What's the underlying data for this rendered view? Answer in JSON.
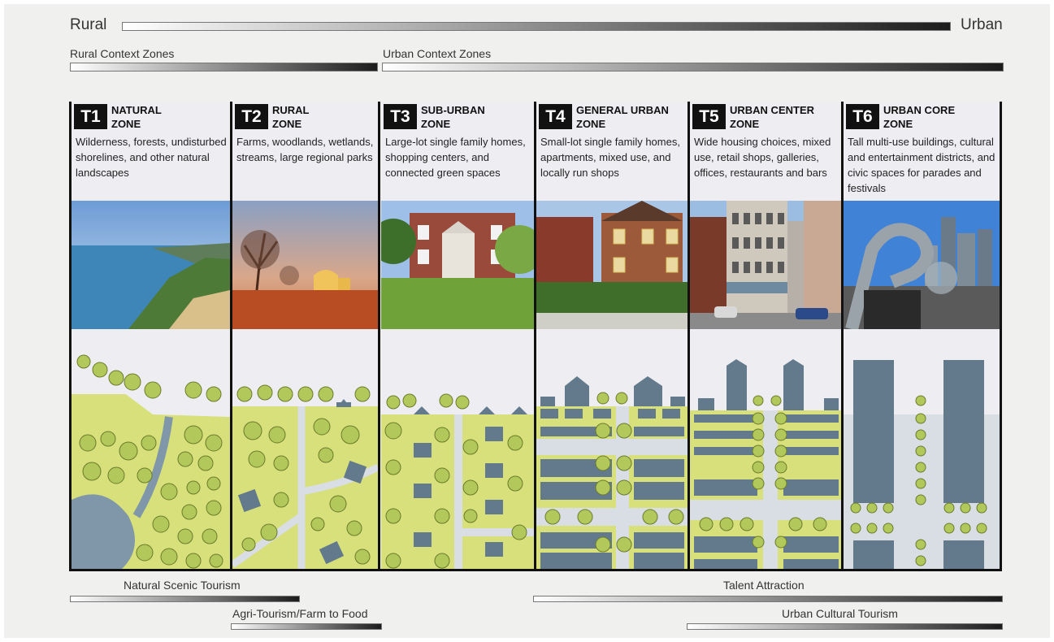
{
  "scale": {
    "left_label": "Rural",
    "right_label": "Urban"
  },
  "context_zones": {
    "rural": "Rural Context Zones",
    "urban": "Urban Context Zones"
  },
  "zones": [
    {
      "badge": "T1",
      "name_line1": "NATURAL",
      "name_line2": "ZONE",
      "description": "Wilderness, forests, undisturbed shorelines, and other natural landscapes"
    },
    {
      "badge": "T2",
      "name_line1": "RURAL",
      "name_line2": "ZONE",
      "description": "Farms, woodlands, wetlands, streams, large regional parks"
    },
    {
      "badge": "T3",
      "name_line1": "SUB-URBAN",
      "name_line2": "ZONE",
      "description": "Large-lot single family homes, shopping centers, and connected green spaces"
    },
    {
      "badge": "T4",
      "name_line1": "GENERAL URBAN",
      "name_line2": "ZONE",
      "description": "Small-lot single family homes, apartments, mixed use, and locally run shops"
    },
    {
      "badge": "T5",
      "name_line1": "URBAN CENTER",
      "name_line2": "ZONE",
      "description": "Wide housing choices, mixed use, retail shops, galleries, offices, restaurants and bars"
    },
    {
      "badge": "T6",
      "name_line1": "URBAN CORE",
      "name_line2": "ZONE",
      "description": "Tall multi-use buildings, cultural and entertainment districts, and civic spaces for parades and festivals"
    }
  ],
  "tourism": {
    "natural_scenic": "Natural Scenic Tourism",
    "agri": "Agri-Tourism/Farm to Food",
    "talent": "Talent Attraction",
    "urban_cultural": "Urban Cultural Tourism"
  },
  "colors": {
    "plan_green": "#d7e07a",
    "tree_green": "#b3c85a",
    "building": "#637a8c",
    "water": "#7f97a8",
    "road": "#d9dde4"
  }
}
